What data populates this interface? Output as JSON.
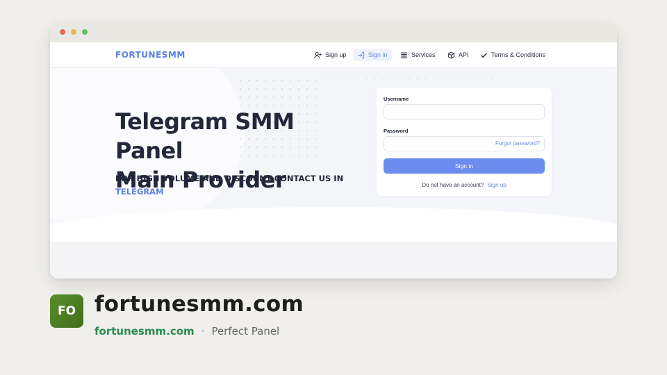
{
  "browser": {
    "window_controls": [
      "close",
      "minimize",
      "maximize"
    ]
  },
  "navbar": {
    "brand": "FORTUNESMM",
    "items": [
      {
        "label": "Sign up",
        "icon": "user-plus-icon",
        "active": false
      },
      {
        "label": "Sign in",
        "icon": "sign-in-icon",
        "active": true
      },
      {
        "label": "Services",
        "icon": "list-icon",
        "active": false
      },
      {
        "label": "API",
        "icon": "cube-icon",
        "active": false
      },
      {
        "label": "Terms & Conditions",
        "icon": "check-icon",
        "active": false
      }
    ]
  },
  "hero": {
    "title_line1": "Telegram SMM Panel",
    "title_line2": "Main Provider",
    "subtitle": "FOR HIGH VOLUME AND DISCOUNT CONTACT US IN",
    "subtitle_link": "TELEGRAM"
  },
  "login": {
    "username_label": "Username",
    "username_value": "",
    "password_label": "Password",
    "password_value": "",
    "forgot_link": "Forgot password?",
    "submit_label": "Sign in",
    "no_account_text": "Do not have an account?",
    "signup_link": "Sign up"
  },
  "site_card": {
    "logo_text": "FO",
    "title": "fortunesmm.com",
    "domain": "fortunesmm.com",
    "separator": "·",
    "description": "Perfect Panel"
  },
  "colors": {
    "accent": "#5b7fe0",
    "button": "#6d8cf0",
    "heading": "#22273a",
    "logo_bg": "#4f8424",
    "domain_text": "#2a8a52"
  }
}
